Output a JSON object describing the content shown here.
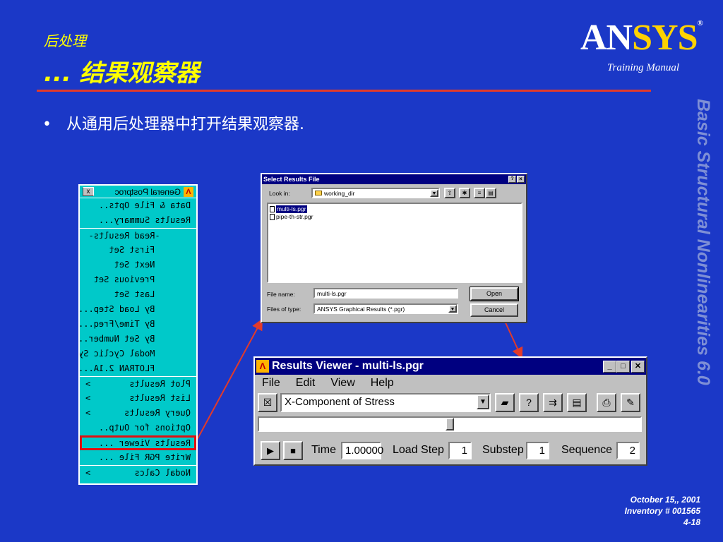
{
  "header": {
    "title_line1": "后处理",
    "title_line2": "... 结果观察器",
    "logo_an": "AN",
    "logo_sys": "SYS",
    "logo_reg": "®",
    "training_manual": "Training Manual"
  },
  "bullet": {
    "dot": "•",
    "text": "从通用后处理器中打开结果观察器."
  },
  "sidebar_text": "Basic Structural Nonlinearities 6.0",
  "footer": {
    "date": "October 15,, 2001",
    "inventory": "Inventory # 001565",
    "page": "4-18"
  },
  "postproc_menu": {
    "title": "General Postproc",
    "close": "x",
    "items": [
      {
        "label": "Data & File Opts..",
        "sep": false
      },
      {
        "label": "Results Summary...",
        "sep": false
      },
      {
        "label": "      -Read Results-",
        "sep": true
      },
      {
        "label": "       First Set",
        "sep": false
      },
      {
        "label": "       Next Set",
        "sep": false
      },
      {
        "label": "       Previous Set",
        "sep": false
      },
      {
        "label": "       Last Set",
        "sep": false
      },
      {
        "label": "       By Load Step...",
        "sep": false
      },
      {
        "label": "       By Time/Freq...",
        "sep": false
      },
      {
        "label": "       By Set Number..",
        "sep": false
      },
      {
        "label": "       Modal Cyclic Sym..",
        "sep": false
      },
      {
        "label": "       FLOTRAN 2.1A...",
        "sep": false
      },
      {
        "label": "Plot Results",
        "sep": true,
        "arrow": ">"
      },
      {
        "label": "List Results",
        "sep": false,
        "arrow": ">"
      },
      {
        "label": "Query Results",
        "sep": false,
        "arrow": ">"
      },
      {
        "label": "Options for Outp..",
        "sep": false
      },
      {
        "label": "Results Viewer ...",
        "sep": true,
        "highlight": true
      },
      {
        "label": "Write PGR File ...",
        "sep": false
      },
      {
        "label": "Nodal Calcs",
        "sep": true,
        "arrow": ">"
      }
    ]
  },
  "select_results_dialog": {
    "title": "Select Results File",
    "help": "?",
    "close": "×",
    "look_in_label": "Look in:",
    "look_in_value": "working_dir",
    "files": [
      "multi-ls.pgr",
      "pipe-th-str.pgr"
    ],
    "selected_file_index": 0,
    "file_name_label": "File name:",
    "file_name_value": "multi-ls.pgr",
    "file_type_label": "Files of type:",
    "file_type_value": "ANSYS Graphical Results (*.pgr)",
    "open_button": "Open",
    "cancel_button": "Cancel"
  },
  "results_viewer": {
    "title": "Results Viewer -  multi-ls.pgr",
    "menus": [
      "File",
      "Edit",
      "View",
      "Help"
    ],
    "item_select_value": "X-Component of Stress",
    "time_label": "Time",
    "time_value": "1.00000",
    "load_step_label": "Load Step",
    "load_step_value": "1",
    "substep_label": "Substep",
    "substep_value": "1",
    "sequence_label": "Sequence",
    "sequence_value": "2"
  },
  "colors": {
    "background": "#1b38c7",
    "title": "#ffff00",
    "rule": "#e23a2a",
    "menu": "#00c9c9",
    "highlight": "#e01010"
  }
}
